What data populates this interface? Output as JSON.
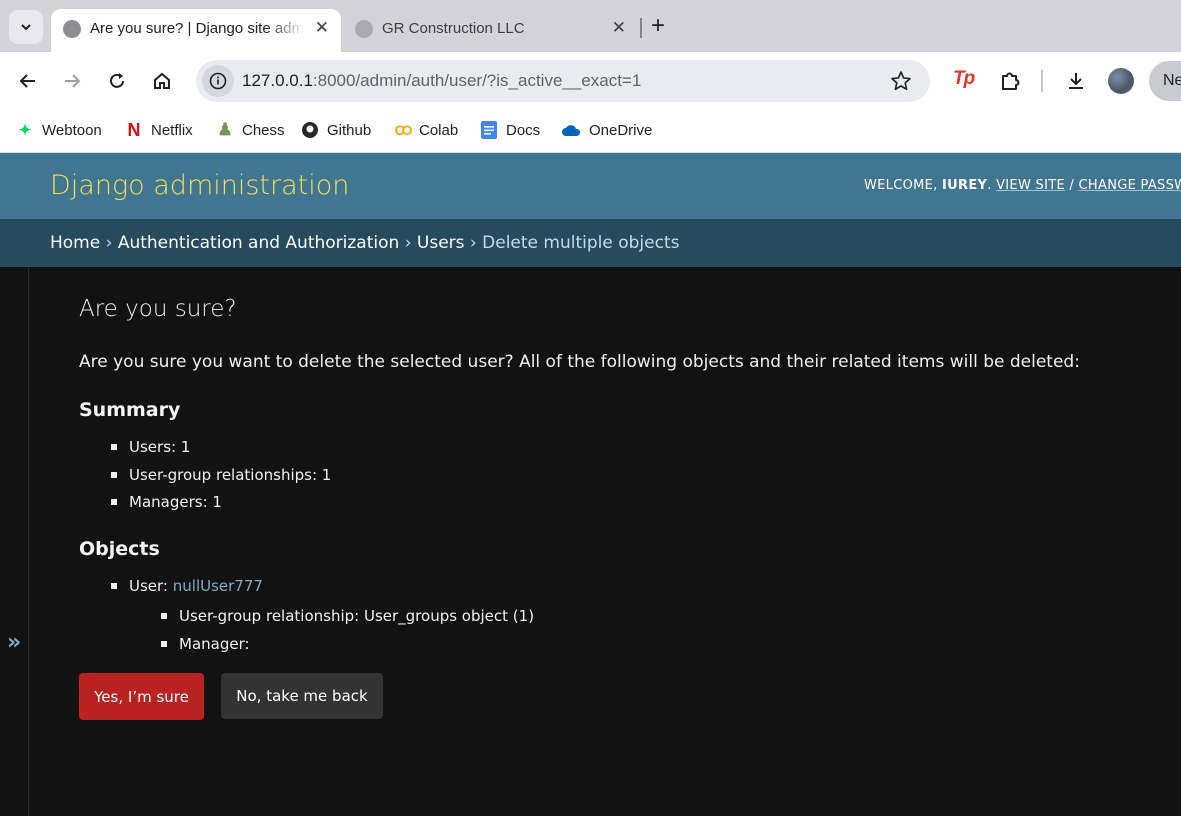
{
  "browser": {
    "tabs": [
      {
        "title": "Are you sure? | Django site admin",
        "active": true
      },
      {
        "title": "GR Construction LLC",
        "active": false
      }
    ],
    "url_host": "127.0.0.1",
    "url_path": ":8000/admin/auth/user/?is_active__exact=1",
    "extension_label": "Tp",
    "profile_label": "Ne",
    "bookmarks": [
      {
        "label": "Webtoon",
        "icon": "webtoon-icon",
        "color": "#00d564"
      },
      {
        "label": "Netflix",
        "icon": "netflix-icon",
        "color": "#e50914"
      },
      {
        "label": "Chess",
        "icon": "chess-icon",
        "color": "#769656"
      },
      {
        "label": "Github",
        "icon": "github-icon",
        "color": "#24292f"
      },
      {
        "label": "Colab",
        "icon": "colab-icon",
        "color": "#f9ab00"
      },
      {
        "label": "Docs",
        "icon": "docs-icon",
        "color": "#4285f4"
      },
      {
        "label": "OneDrive",
        "icon": "onedrive-icon",
        "color": "#0364b8"
      }
    ]
  },
  "admin": {
    "site_title": "Django administration",
    "user_tools": {
      "welcome": "WELCOME,",
      "username": "IUREY",
      "view_site": "VIEW SITE",
      "separator": "/",
      "change_password": "CHANGE PASSWORD"
    },
    "breadcrumbs": [
      {
        "label": "Home",
        "link": true
      },
      {
        "label": "Authentication and Authorization",
        "link": true
      },
      {
        "label": "Users",
        "link": true
      },
      {
        "label": "Delete multiple objects",
        "link": false
      }
    ],
    "breadcrumb_separator": "›",
    "sidebar_toggle": "»"
  },
  "content": {
    "title": "Are you sure?",
    "intro": "Are you sure you want to delete the selected user? All of the following objects and their related items will be deleted:",
    "summary_heading": "Summary",
    "summary": [
      "Users: 1",
      "User-group relationships: 1",
      "Managers: 1"
    ],
    "objects_heading": "Objects",
    "object_prefix": "User:",
    "object_link": "nullUser777",
    "related": [
      "User-group relationship: User_groups object (1)",
      "Manager:"
    ],
    "confirm_label": "Yes, I’m sure",
    "cancel_label": "No, take me back"
  },
  "colors": {
    "header_bg": "#417690",
    "breadcrumbs_bg": "#264b5d",
    "branding": "#f5dd5d",
    "danger": "#ba2121",
    "link": "#79aec8",
    "body_bg": "#121212"
  }
}
